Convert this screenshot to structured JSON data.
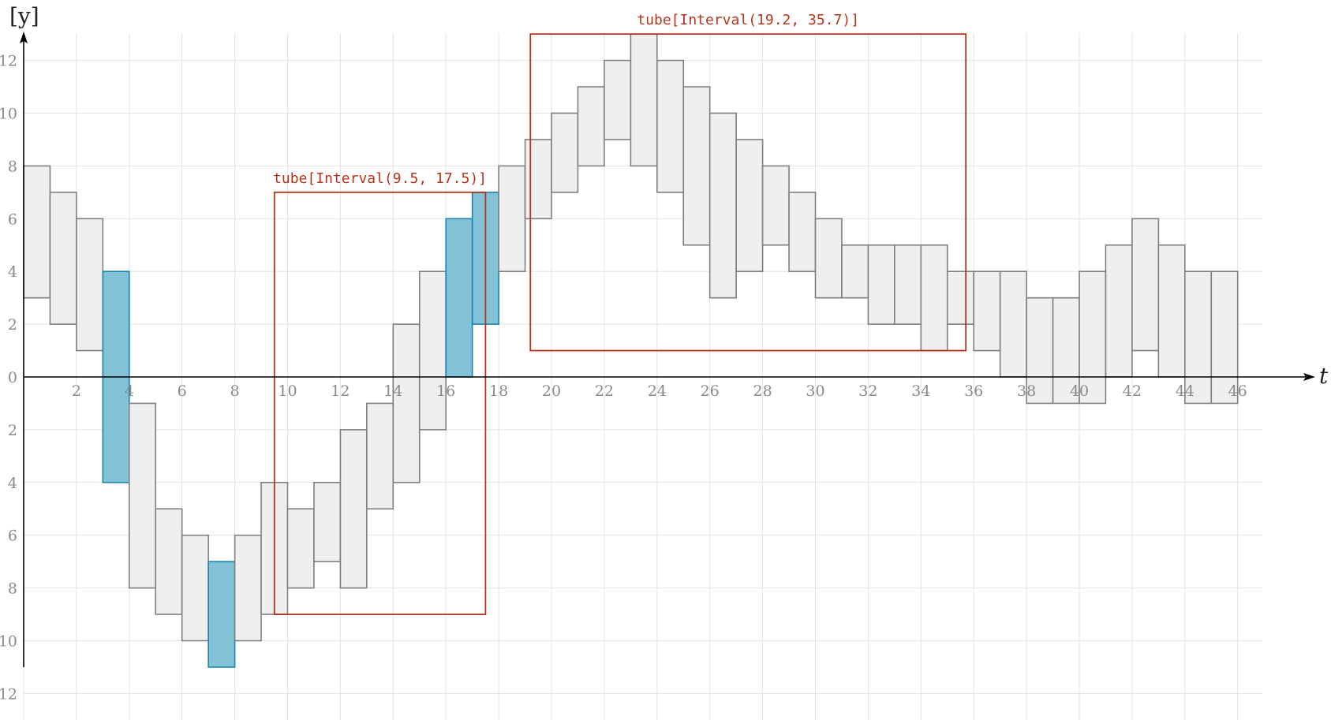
{
  "chart_data": {
    "type": "interval",
    "xlabel": "t",
    "ylabel": "[y]",
    "xlim": [
      0,
      47
    ],
    "ylim": [
      -13,
      13
    ],
    "xticks": [
      2,
      4,
      6,
      8,
      10,
      12,
      14,
      16,
      18,
      20,
      22,
      24,
      26,
      28,
      30,
      32,
      34,
      36,
      38,
      40,
      42,
      44,
      46
    ],
    "yticks": [
      12,
      10,
      8,
      6,
      4,
      2,
      0,
      -2,
      -4,
      -6,
      -8,
      -10,
      -12
    ],
    "ytick_labels": [
      "12",
      "10",
      "8",
      "6",
      "4",
      "2",
      "0",
      "2",
      "4",
      "6",
      "8",
      "10",
      "12"
    ],
    "grid": true,
    "colors": {
      "box_fill": "#efefef",
      "box_stroke": "#7f7f7f",
      "highlight_fill": "#84c2d8",
      "highlight_stroke": "#1b84ad",
      "tube": "#b5341c"
    },
    "boxes": [
      {
        "t0": 0,
        "t1": 1,
        "ylo": 3,
        "yhi": 8
      },
      {
        "t0": 1,
        "t1": 2,
        "ylo": 2,
        "yhi": 7
      },
      {
        "t0": 2,
        "t1": 3,
        "ylo": 1,
        "yhi": 6
      },
      {
        "t0": 3,
        "t1": 4,
        "ylo": -4,
        "yhi": 4,
        "highlight": true
      },
      {
        "t0": 4,
        "t1": 5,
        "ylo": -8,
        "yhi": -1
      },
      {
        "t0": 5,
        "t1": 6,
        "ylo": -9,
        "yhi": -5
      },
      {
        "t0": 6,
        "t1": 7,
        "ylo": -10,
        "yhi": -6
      },
      {
        "t0": 7,
        "t1": 8,
        "ylo": -11,
        "yhi": -7,
        "highlight": true
      },
      {
        "t0": 8,
        "t1": 9,
        "ylo": -10,
        "yhi": -6
      },
      {
        "t0": 9,
        "t1": 10,
        "ylo": -9,
        "yhi": -4
      },
      {
        "t0": 10,
        "t1": 11,
        "ylo": -8,
        "yhi": -5
      },
      {
        "t0": 11,
        "t1": 12,
        "ylo": -7,
        "yhi": -4
      },
      {
        "t0": 12,
        "t1": 13,
        "ylo": -8,
        "yhi": -2
      },
      {
        "t0": 13,
        "t1": 14,
        "ylo": -5,
        "yhi": -1
      },
      {
        "t0": 14,
        "t1": 15,
        "ylo": -4,
        "yhi": 2
      },
      {
        "t0": 15,
        "t1": 16,
        "ylo": -2,
        "yhi": 4
      },
      {
        "t0": 16,
        "t1": 17,
        "ylo": 0,
        "yhi": 6,
        "highlight": true
      },
      {
        "t0": 17,
        "t1": 18,
        "ylo": 2,
        "yhi": 7,
        "highlight": true
      },
      {
        "t0": 18,
        "t1": 19,
        "ylo": 4,
        "yhi": 8
      },
      {
        "t0": 19,
        "t1": 20,
        "ylo": 6,
        "yhi": 9
      },
      {
        "t0": 20,
        "t1": 21,
        "ylo": 7,
        "yhi": 10
      },
      {
        "t0": 21,
        "t1": 22,
        "ylo": 8,
        "yhi": 11
      },
      {
        "t0": 22,
        "t1": 23,
        "ylo": 9,
        "yhi": 12
      },
      {
        "t0": 23,
        "t1": 24,
        "ylo": 8,
        "yhi": 13
      },
      {
        "t0": 24,
        "t1": 25,
        "ylo": 7,
        "yhi": 12
      },
      {
        "t0": 25,
        "t1": 26,
        "ylo": 5,
        "yhi": 11
      },
      {
        "t0": 26,
        "t1": 27,
        "ylo": 3,
        "yhi": 10
      },
      {
        "t0": 27,
        "t1": 28,
        "ylo": 4,
        "yhi": 9
      },
      {
        "t0": 28,
        "t1": 29,
        "ylo": 5,
        "yhi": 8
      },
      {
        "t0": 29,
        "t1": 30,
        "ylo": 4,
        "yhi": 7
      },
      {
        "t0": 30,
        "t1": 31,
        "ylo": 3,
        "yhi": 6
      },
      {
        "t0": 31,
        "t1": 32,
        "ylo": 3,
        "yhi": 5
      },
      {
        "t0": 32,
        "t1": 33,
        "ylo": 2,
        "yhi": 5
      },
      {
        "t0": 33,
        "t1": 34,
        "ylo": 2,
        "yhi": 5
      },
      {
        "t0": 34,
        "t1": 35,
        "ylo": 1,
        "yhi": 5
      },
      {
        "t0": 35,
        "t1": 36,
        "ylo": 2,
        "yhi": 4
      },
      {
        "t0": 36,
        "t1": 37,
        "ylo": 1,
        "yhi": 4
      },
      {
        "t0": 37,
        "t1": 38,
        "ylo": 0,
        "yhi": 4
      },
      {
        "t0": 38,
        "t1": 39,
        "ylo": -1,
        "yhi": 3
      },
      {
        "t0": 39,
        "t1": 40,
        "ylo": -1,
        "yhi": 3
      },
      {
        "t0": 40,
        "t1": 41,
        "ylo": -1,
        "yhi": 4
      },
      {
        "t0": 41,
        "t1": 42,
        "ylo": 0,
        "yhi": 5
      },
      {
        "t0": 42,
        "t1": 43,
        "ylo": 1,
        "yhi": 6
      },
      {
        "t0": 43,
        "t1": 44,
        "ylo": 0,
        "yhi": 5
      },
      {
        "t0": 44,
        "t1": 45,
        "ylo": -1,
        "yhi": 4
      },
      {
        "t0": 45,
        "t1": 46,
        "ylo": -1,
        "yhi": 4
      }
    ],
    "tubes": [
      {
        "label": "tube[Interval(9.5, 17.5)]",
        "t0": 9.5,
        "t1": 17.5,
        "ylo": -9,
        "yhi": 7
      },
      {
        "label": "tube[Interval(19.2, 35.7)]",
        "t0": 19.2,
        "t1": 35.7,
        "ylo": 1,
        "yhi": 13
      }
    ]
  }
}
